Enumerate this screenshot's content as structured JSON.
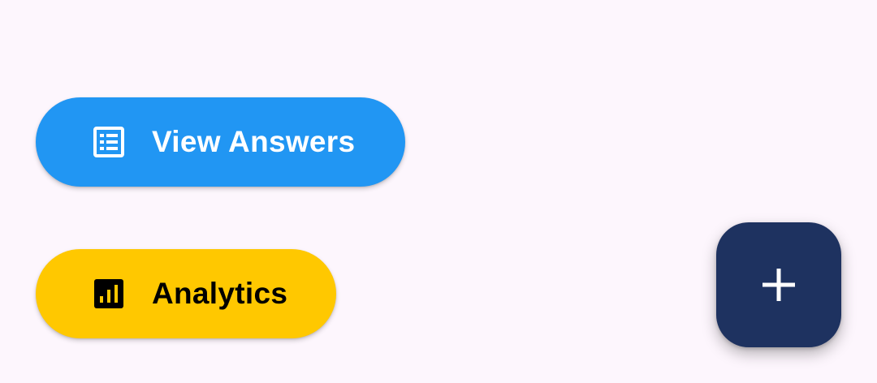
{
  "actions": {
    "view_answers": {
      "label": "View Answers",
      "icon": "list-alt-icon",
      "color": "#2196f3",
      "text_color": "#ffffff"
    },
    "analytics": {
      "label": "Analytics",
      "icon": "bar-chart-icon",
      "color": "#ffc800",
      "text_color": "#000000"
    }
  },
  "fab": {
    "icon": "plus-icon",
    "color": "#1e3260"
  },
  "background": "#fdf6fd"
}
